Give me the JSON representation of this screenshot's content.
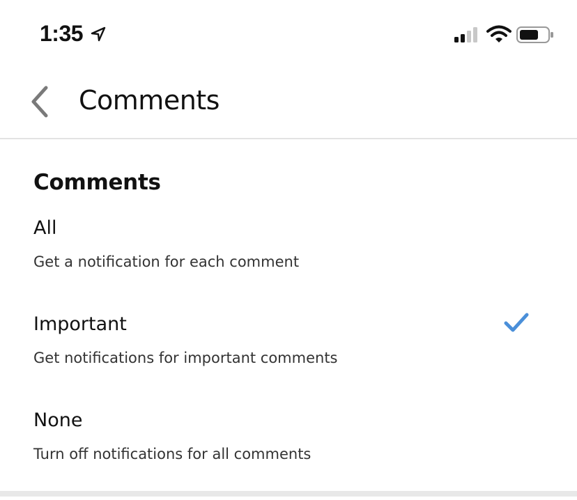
{
  "status_bar": {
    "time": "1:35",
    "icons": [
      "location-arrow-icon",
      "signal-icon",
      "wifi-icon",
      "battery-icon"
    ]
  },
  "nav": {
    "back_icon": "chevron-left-icon",
    "title": "Comments"
  },
  "section": {
    "heading": "Comments"
  },
  "options": [
    {
      "title": "All",
      "description": "Get a notification for each comment",
      "selected": false
    },
    {
      "title": "Important",
      "description": "Get notifications for important comments",
      "selected": true
    },
    {
      "title": "None",
      "description": "Turn off notifications for all comments",
      "selected": false
    }
  ],
  "colors": {
    "accent": "#4a8fd9",
    "divider": "#e3e3e3",
    "text": "#111111"
  }
}
